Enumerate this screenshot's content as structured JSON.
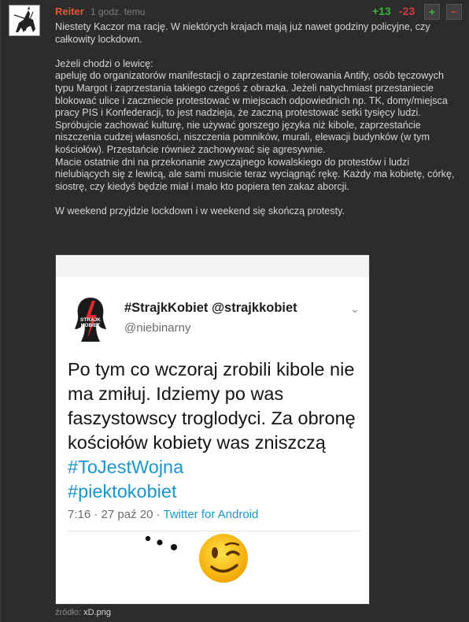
{
  "comment": {
    "author": "Reiter",
    "time": "1 godz. temu",
    "votes_plus": "+13",
    "votes_minus": "-23",
    "upvote_icon": "plus-icon",
    "downvote_icon": "minus-icon",
    "upvote_label": "+",
    "downvote_label": "−",
    "paragraphs": [
      "Niestety Kaczor ma rację. W niektórych krajach mają już nawet godziny policyjne, czy całkowity lockdown.",
      "",
      "Jeżeli chodzi o lewicę:",
      "apeluję do organizatorów manifestacji o zaprzestanie tolerowania Antify, osób tęczowych typu Margot i zaprzestania takiego czegoś z obrazka. Jeżeli natychmiast przestaniecie blokować ulice i zaczniecie protestować w miejscach odpowiednich np. TK, domy/miejsca pracy PIS i Konfederacji, to jest nadzieja, że zaczną protestować setki tysięcy ludzi. Spróbujcie zachować kulturę, nie używać gorszego języka niż kibole, zaprzestańcie niszczenia cudzej własności, niszczenia pomników, murali, elewacji budynków (w tym kościołów). Przestańcie również zachowywać się agresywnie.",
      "Macie ostatnie dni na przekonanie zwyczajnego kowalskiego do protestów i ludzi nielubiących się z lewicą, ale sami musicie teraz wyciągnąć rękę. Każdy ma kobietę, córkę, siostrę, czy kiedyś będzie miał i mało kto popiera ten zakaz aborcji.",
      "",
      "W weekend przyjdzie lockdown i w weekend się skończą protesty."
    ],
    "source_label": "źródło:",
    "source_file": "xD.png"
  },
  "tweet": {
    "logo_icon": "strajk-kobiet-logo-icon",
    "logo_text_1": "STRAJK",
    "logo_text_2": "KOBIET",
    "name": "#StrajkKobiet @strajkkobiet",
    "handle": "@niebinarny",
    "chevron_icon": "chevron-down-icon",
    "text_plain": "Po tym co wczoraj zrobili kibole nie ma zmiłuj. Idziemy po was faszystowscy troglodyci. Za obronę kościołów kobiety was zniszczą ",
    "hashtag1": "#ToJestWojna",
    "hashtag2": "#piektokobiet",
    "meta_time": "7:16 · 27 paź 20 · ",
    "meta_client": "Twitter for Android",
    "emoji_icon": "winking-face-emoji-icon"
  },
  "colors": {
    "author": "#e0573a",
    "plus": "#3bb33b",
    "minus": "#d13a3a",
    "hashtag": "#1b95c9",
    "logo_red": "#e8262b"
  }
}
